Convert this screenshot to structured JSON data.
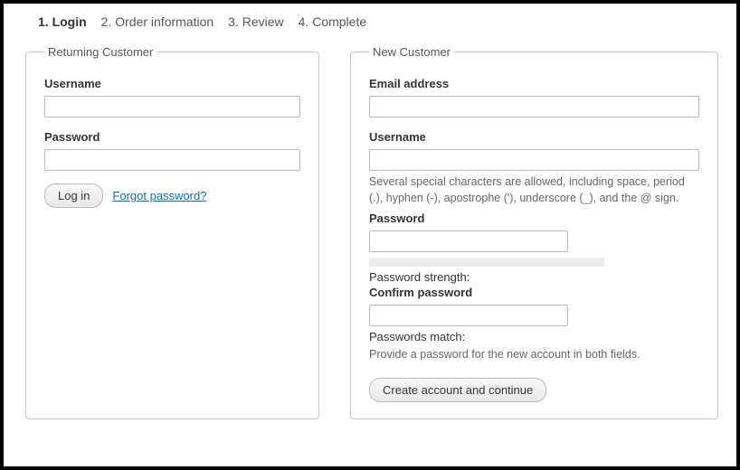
{
  "steps": [
    "1. Login",
    "2. Order information",
    "3. Review",
    "4. Complete"
  ],
  "returning": {
    "legend": "Returning Customer",
    "username_label": "Username",
    "username_value": "",
    "password_label": "Password",
    "password_value": "",
    "login_button": "Log in",
    "forgot_link": "Forgot password?"
  },
  "newcust": {
    "legend": "New Customer",
    "email_label": "Email address",
    "email_value": "",
    "username_label": "Username",
    "username_value": "",
    "username_hint": "Several special characters are allowed, including space, period (.), hyphen (-), apostrophe ('), underscore (_), and the @ sign.",
    "password_label": "Password",
    "password_value": "",
    "strength_label": "Password strength:",
    "confirm_label": "Confirm password",
    "confirm_value": "",
    "match_label": "Passwords match:",
    "password_hint": "Provide a password for the new account in both fields.",
    "create_button": "Create account and continue"
  }
}
